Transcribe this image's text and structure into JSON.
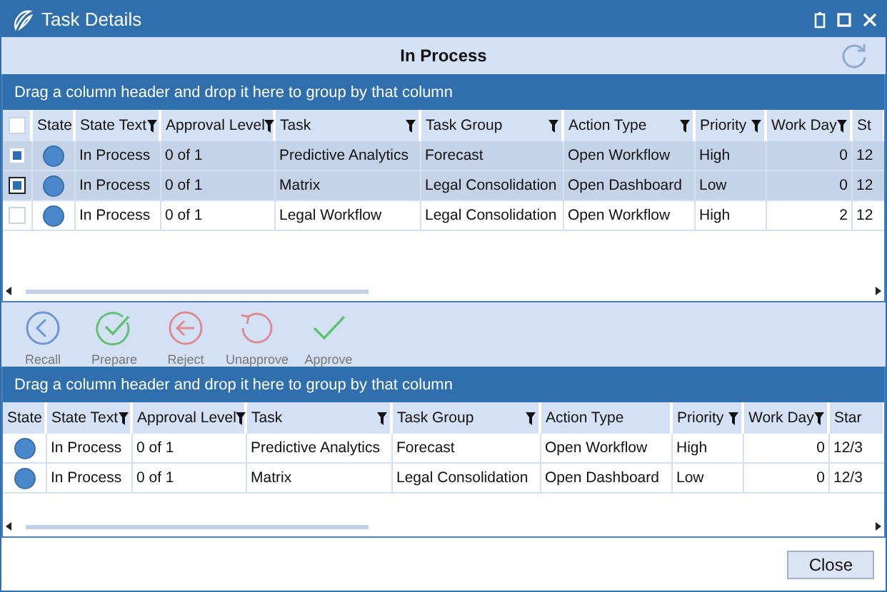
{
  "window": {
    "title": "Task Details"
  },
  "header": {
    "title": "In Process"
  },
  "top_grid": {
    "select_all": {
      "checked": false
    },
    "group_hint": "Drag a column header and drop it here to group by that column",
    "columns": [
      {
        "label": "State",
        "filter": false
      },
      {
        "label": "State Text",
        "filter": true
      },
      {
        "label": "Approval Level",
        "filter": true
      },
      {
        "label": "Task",
        "filter": true
      },
      {
        "label": "Task Group",
        "filter": true
      },
      {
        "label": "Action Type",
        "filter": true
      },
      {
        "label": "Priority",
        "filter": true
      },
      {
        "label": "Work Day",
        "filter": true
      },
      {
        "label": "St",
        "filter": false
      }
    ],
    "rows": [
      {
        "selected": true,
        "current": false,
        "cells": [
          "",
          "In Process",
          "0 of 1",
          "Predictive Analytics",
          "Forecast",
          "Open Workflow",
          "High",
          "0",
          "12"
        ]
      },
      {
        "selected": true,
        "current": true,
        "cells": [
          "",
          "In Process",
          "0 of 1",
          "Matrix",
          "Legal Consolidation",
          "Open Dashboard",
          "Low",
          "0",
          "12"
        ]
      },
      {
        "selected": false,
        "current": false,
        "cells": [
          "",
          "In Process",
          "0 of 1",
          "Legal Workflow",
          "Legal Consolidation",
          "Open Workflow",
          "High",
          "2",
          "12"
        ]
      }
    ]
  },
  "toolbar": [
    {
      "kind": "recall",
      "label": "Recall",
      "disabled": true
    },
    {
      "kind": "prepare",
      "label": "Prepare",
      "disabled": true
    },
    {
      "kind": "reject",
      "label": "Reject",
      "disabled": true
    },
    {
      "kind": "unapprove",
      "label": "Unapprove",
      "disabled": true
    },
    {
      "kind": "approve",
      "label": "Approve",
      "disabled": true
    }
  ],
  "bottom_grid": {
    "group_hint": "Drag a column header and drop it here to group by that column",
    "columns": [
      {
        "label": "State",
        "filter": false
      },
      {
        "label": "State Text",
        "filter": true
      },
      {
        "label": "Approval Level",
        "filter": true
      },
      {
        "label": "Task",
        "filter": true
      },
      {
        "label": "Task Group",
        "filter": true
      },
      {
        "label": "Action Type",
        "filter": false
      },
      {
        "label": "Priority",
        "filter": true
      },
      {
        "label": "Work Day",
        "filter": true
      },
      {
        "label": "Star",
        "filter": false
      }
    ],
    "rows": [
      {
        "cells": [
          "",
          "In Process",
          "0 of 1",
          "Predictive Analytics",
          "Forecast",
          "Open Workflow",
          "High",
          "0",
          "12/3"
        ]
      },
      {
        "cells": [
          "",
          "In Process",
          "0 of 1",
          "Matrix",
          "Legal Consolidation",
          "Open Dashboard",
          "Low",
          "0",
          "12/3"
        ]
      }
    ]
  },
  "buttons": [
    {
      "label": "Close"
    }
  ]
}
